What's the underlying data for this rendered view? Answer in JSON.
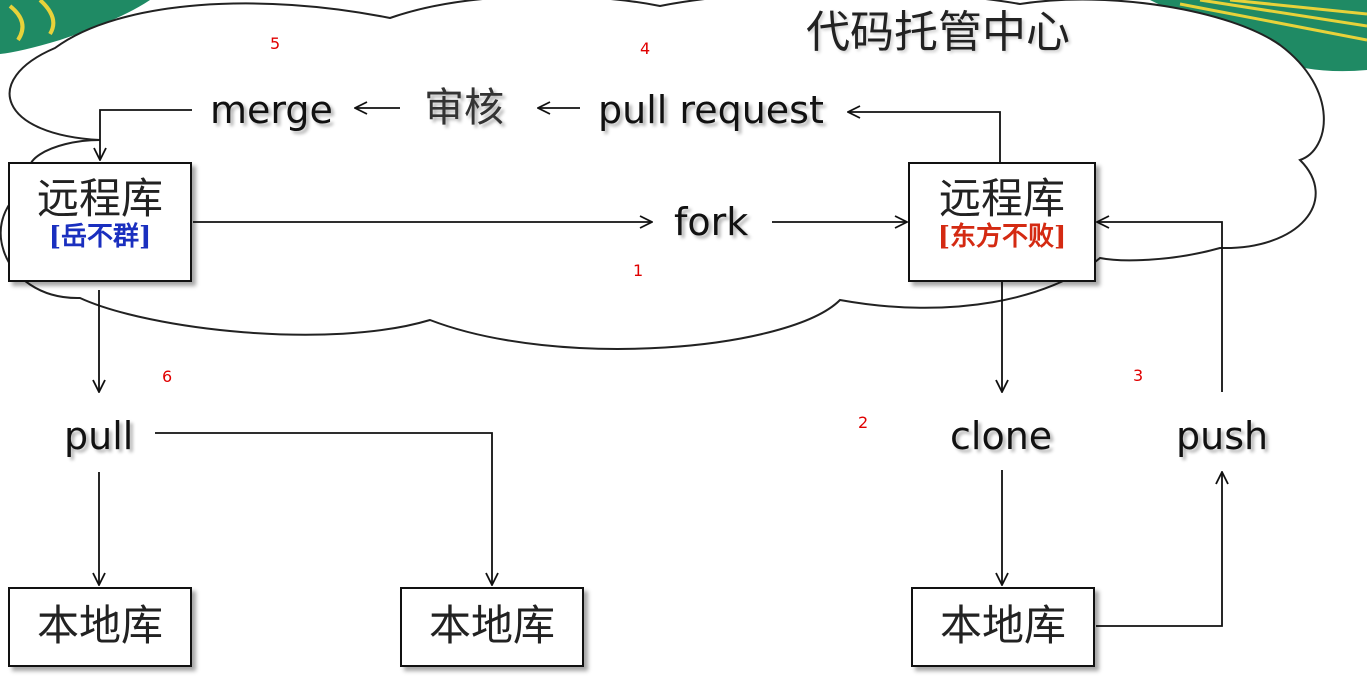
{
  "diagram": {
    "title": "代码托管中心",
    "remote_left": {
      "name": "远程库",
      "owner": "[岳不群]",
      "owner_color": "#1a2fbf"
    },
    "remote_right": {
      "name": "远程库",
      "owner": "[东方不败]",
      "owner_color": "#d42a12"
    },
    "local_repo_label": "本地库",
    "actions": {
      "merge": "merge",
      "review": "审核",
      "pull_request": "pull request",
      "fork": "fork",
      "pull": "pull",
      "clone": "clone",
      "push": "push"
    },
    "steps": [
      "1",
      "2",
      "3",
      "4",
      "5",
      "6"
    ],
    "colors": {
      "step_number": "#e00000",
      "outline": "#111111",
      "decor_green": "#1f8a64",
      "decor_yellow": "#e7d23a"
    }
  }
}
